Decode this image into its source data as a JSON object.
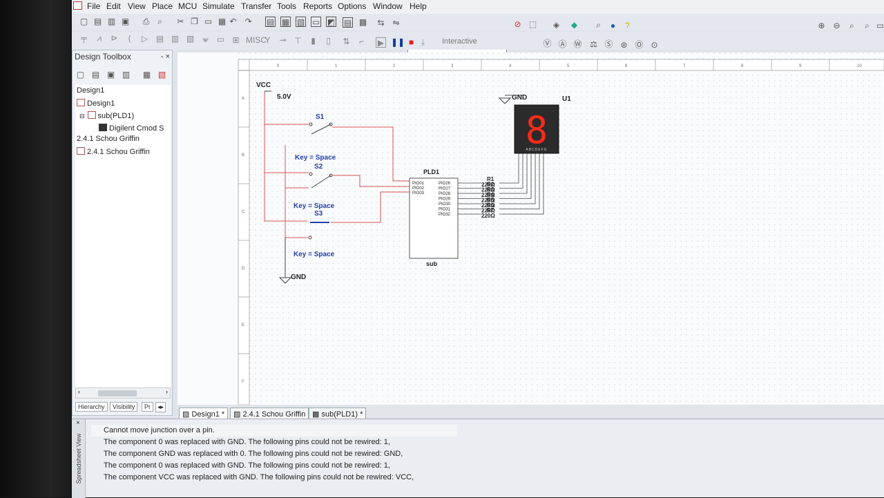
{
  "menu": [
    "File",
    "Edit",
    "View",
    "Place",
    "MCU",
    "Simulate",
    "Transfer",
    "Tools",
    "Reports",
    "Options",
    "Window",
    "Help"
  ],
  "toolbar": {
    "in_use_list": "--- In-Use List ---",
    "interactive_label": "Interactive"
  },
  "design_toolbox": {
    "title": "Design Toolbox",
    "controls": "- ×",
    "tree": [
      "Design1",
      "Design1",
      "sub(PLD1)",
      "Digilent Cmod S",
      "2.4.1 Schou Griffin",
      "2.4.1 Schou Griffin"
    ],
    "tabs": [
      "Hierarchy",
      "Visibility",
      "Pr"
    ]
  },
  "schematic": {
    "vcc": "VCC",
    "vcc_value": "5.0V",
    "switches": [
      "S1",
      "S2",
      "S3"
    ],
    "key_label": "Key = Space",
    "gnd": "GND",
    "pld_ref": "PLD1",
    "pld_sub": "sub",
    "pld_left_pins": [
      "PIO01",
      "PIO02",
      "PIO03"
    ],
    "pld_right_pins": [
      "PIO26",
      "PIO27",
      "PIO28",
      "PIO29",
      "PIO30",
      "PIO31",
      "PIO32"
    ],
    "resistors": [
      "R1",
      "R2",
      "R3",
      "R4",
      "R5",
      "R6",
      "R7"
    ],
    "resistor_value": "220Ω",
    "display_ref": "U1",
    "display_gnd": "GND",
    "display_digit": "8",
    "display_pins": "ABCDEFG",
    "ruler_cols": [
      "0",
      "1",
      "2",
      "3",
      "4",
      "5",
      "6",
      "7",
      "8",
      "9",
      "10"
    ],
    "ruler_rows": [
      "A",
      "B",
      "C",
      "D",
      "E",
      "F"
    ]
  },
  "doc_tabs": [
    "Design1 *",
    "2.4.1 Schou Griffin",
    "sub(PLD1) *"
  ],
  "spreadsheet": {
    "label": "Spreadsheet View",
    "messages": [
      "Cannot move junction over a pin.",
      "The component 0 was replaced with GND. The following pins could not be rewired: 1,",
      "The component GND was replaced with 0. The following pins could not be rewired: GND,",
      "The component 0 was replaced with GND. The following pins could not be rewired: 1,",
      "The component VCC was replaced with GND. The following pins could not be rewired: VCC,"
    ]
  },
  "colors": {
    "wire": "#d9534f",
    "label": "#1f3fa8",
    "segment": "#ff2a1a"
  }
}
